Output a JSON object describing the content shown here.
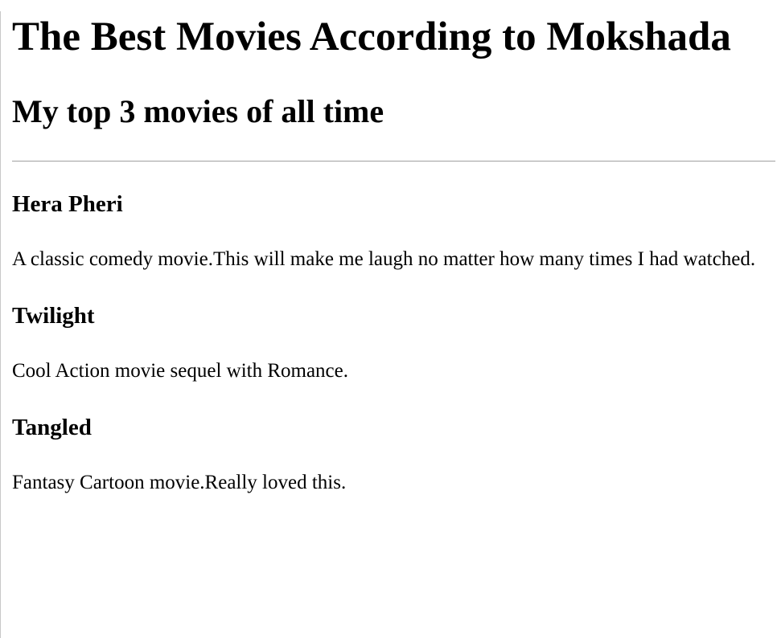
{
  "page": {
    "title": "The Best Movies According to Mokshada",
    "subtitle": "My top 3 movies of all time"
  },
  "movies": [
    {
      "name": "Hera Pheri",
      "description": "A classic comedy movie.This will make me laugh no matter how many times I had watched."
    },
    {
      "name": "Twilight",
      "description": "Cool Action movie sequel with Romance."
    },
    {
      "name": "Tangled",
      "description": "Fantasy Cartoon movie.Really loved this."
    }
  ]
}
